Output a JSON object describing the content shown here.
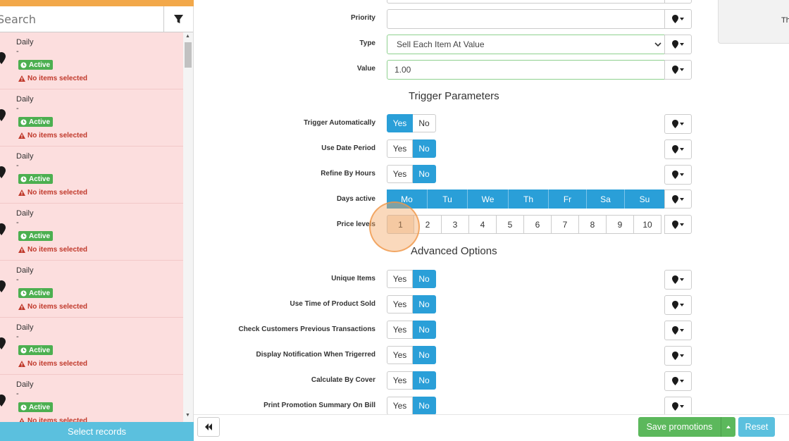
{
  "sidebar": {
    "search_placeholder": "Search",
    "select_records_label": "Select records",
    "records": [
      {
        "title": "Daily",
        "dash": "-",
        "status": "Active",
        "warning": "No items selected"
      },
      {
        "title": "Daily",
        "dash": "-",
        "status": "Active",
        "warning": "No items selected"
      },
      {
        "title": "Daily",
        "dash": "-",
        "status": "Active",
        "warning": "No items selected"
      },
      {
        "title": "Daily",
        "dash": "-",
        "status": "Active",
        "warning": "No items selected"
      },
      {
        "title": "Daily",
        "dash": "-",
        "status": "Active",
        "warning": "No items selected"
      },
      {
        "title": "Daily",
        "dash": "-",
        "status": "Active",
        "warning": "No items selected"
      },
      {
        "title": "Daily",
        "dash": "-",
        "status": "Active",
        "warning": "No items selected"
      }
    ]
  },
  "form": {
    "priority": {
      "label": "Priority",
      "value": ""
    },
    "type": {
      "label": "Type",
      "value": "Sell Each Item At Value"
    },
    "value": {
      "label": "Value",
      "value": "1.00"
    },
    "trigger_section": "Trigger Parameters",
    "trigger_automatically": {
      "label": "Trigger Automatically",
      "yes": "Yes",
      "no": "No",
      "selected": "Yes"
    },
    "use_date_period": {
      "label": "Use Date Period",
      "yes": "Yes",
      "no": "No",
      "selected": "No"
    },
    "refine_by_hours": {
      "label": "Refine By Hours",
      "yes": "Yes",
      "no": "No",
      "selected": "No"
    },
    "days_active": {
      "label": "Days active",
      "days": [
        "Mo",
        "Tu",
        "We",
        "Th",
        "Fr",
        "Sa",
        "Su"
      ]
    },
    "price_levels": {
      "label": "Price levels",
      "levels": [
        "1",
        "2",
        "3",
        "4",
        "5",
        "6",
        "7",
        "8",
        "9",
        "10"
      ],
      "selected": "1"
    },
    "advanced_section": "Advanced Options",
    "unique_items": {
      "label": "Unique Items",
      "yes": "Yes",
      "no": "No",
      "selected": "No"
    },
    "use_time_of_product_sold": {
      "label": "Use Time of Product Sold",
      "yes": "Yes",
      "no": "No",
      "selected": "No"
    },
    "check_customers_previous_transactions": {
      "label": "Check Customers Previous Transactions",
      "yes": "Yes",
      "no": "No",
      "selected": "No"
    },
    "display_notification_when_triggered": {
      "label": "Display Notification When Trigerred",
      "yes": "Yes",
      "no": "No",
      "selected": "No"
    },
    "calculate_by_cover": {
      "label": "Calculate By Cover",
      "yes": "Yes",
      "no": "No",
      "selected": "No"
    },
    "print_promotion_summary_on_bill": {
      "label": "Print Promotion Summary On Bill",
      "yes": "Yes",
      "no": "No",
      "selected": "No"
    }
  },
  "right_card_text": "Th",
  "footer": {
    "save_label": "Save promotions",
    "reset_label": "Reset"
  },
  "colors": {
    "accent_blue": "#2a9fd8",
    "save_green": "#5cb85c",
    "reset_blue": "#5bc0de",
    "list_bg": "#fcdede",
    "top_bar": "#f2a84a"
  }
}
